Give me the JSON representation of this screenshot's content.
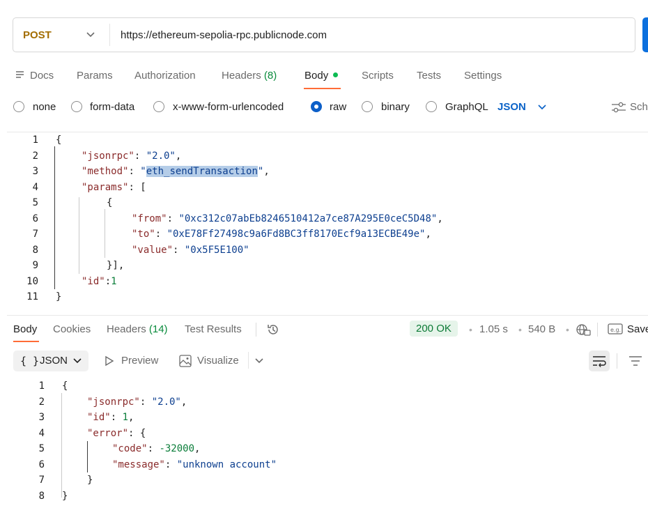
{
  "request": {
    "method": "POST",
    "url": "https://ethereum-sepolia-rpc.publicnode.com"
  },
  "tabs": {
    "docs": "Docs",
    "params": "Params",
    "authorization": "Authorization",
    "headers": "Headers",
    "headers_count": "(8)",
    "body": "Body",
    "scripts": "Scripts",
    "tests": "Tests",
    "settings": "Settings"
  },
  "body_types": {
    "none": "none",
    "form_data": "form-data",
    "urlencoded": "x-www-form-urlencoded",
    "raw": "raw",
    "binary": "binary",
    "graphql": "GraphQL",
    "selected": "raw",
    "format": "JSON",
    "schema_partial": "Sch"
  },
  "request_body": {
    "line_numbers": [
      "1",
      "2",
      "3",
      "4",
      "5",
      "6",
      "7",
      "8",
      "9",
      "10",
      "11"
    ],
    "jsonrpc_key": "\"jsonrpc\"",
    "jsonrpc_val": "\"2.0\"",
    "method_key": "\"method\"",
    "method_val": "eth_sendTransaction",
    "params_key": "\"params\"",
    "from_key": "\"from\"",
    "from_val": "\"0xc312c07abEb8246510412a7ce87A295E0ceC5D48\"",
    "to_key": "\"to\"",
    "to_val": "\"0xE78Ff27498c9a6Fd8BC3ff8170Ecf9a13ECBE49e\"",
    "value_key": "\"value\"",
    "value_val": "\"0x5F5E100\"",
    "id_key": "\"id\"",
    "id_val": "1"
  },
  "response_tabs": {
    "body": "Body",
    "cookies": "Cookies",
    "headers": "Headers",
    "headers_count": "(14)",
    "test_results": "Test Results"
  },
  "response_meta": {
    "status": "200 OK",
    "time": "1.05 s",
    "size": "540 B",
    "save_partial": "Save"
  },
  "response_toolbar": {
    "format": "JSON",
    "preview": "Preview",
    "visualize": "Visualize"
  },
  "response_body": {
    "line_numbers": [
      "1",
      "2",
      "3",
      "4",
      "5",
      "6",
      "7",
      "8"
    ],
    "jsonrpc_key": "\"jsonrpc\"",
    "jsonrpc_val": "\"2.0\"",
    "id_key": "\"id\"",
    "id_val": "1",
    "error_key": "\"error\"",
    "code_key": "\"code\"",
    "code_val": "-32000",
    "message_key": "\"message\"",
    "message_val": "\"unknown account\""
  },
  "icons": {
    "docs": "docs-icon",
    "method_dropdown": "chevron-down-icon",
    "format_dropdown": "chevron-down-icon",
    "schema": "sliders-icon",
    "history": "history-icon",
    "globe": "globe-icon",
    "example": "example-icon",
    "preview": "play-icon",
    "visualize": "image-icon",
    "wrap": "wrap-lines-icon",
    "filter": "filter-icon"
  },
  "colors": {
    "method": "#a36d00",
    "accent": "#ff6c37",
    "link_blue": "#0c63c8",
    "status_ok": "#0b7a35",
    "send_button": "#0c70de"
  }
}
